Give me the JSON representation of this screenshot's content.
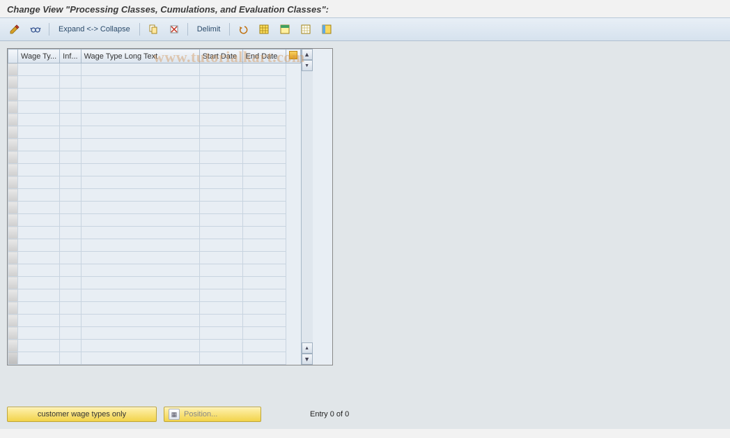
{
  "title": "Change View \"Processing Classes, Cumulations, and Evaluation Classes\":",
  "toolbar": {
    "expand_collapse": "Expand <-> Collapse",
    "delimit": "Delimit"
  },
  "columns": {
    "rowsel": "",
    "wage_type": "Wage Ty...",
    "inf": "Inf...",
    "long_text": "Wage Type Long Text",
    "start_date": "Start Date",
    "end_date": "End Date"
  },
  "rows_count": 24,
  "footer": {
    "customer_btn": "customer wage types only",
    "position_btn": "Position...",
    "entry_text": "Entry 0 of 0"
  },
  "watermark": "www.tutorialkart.com"
}
